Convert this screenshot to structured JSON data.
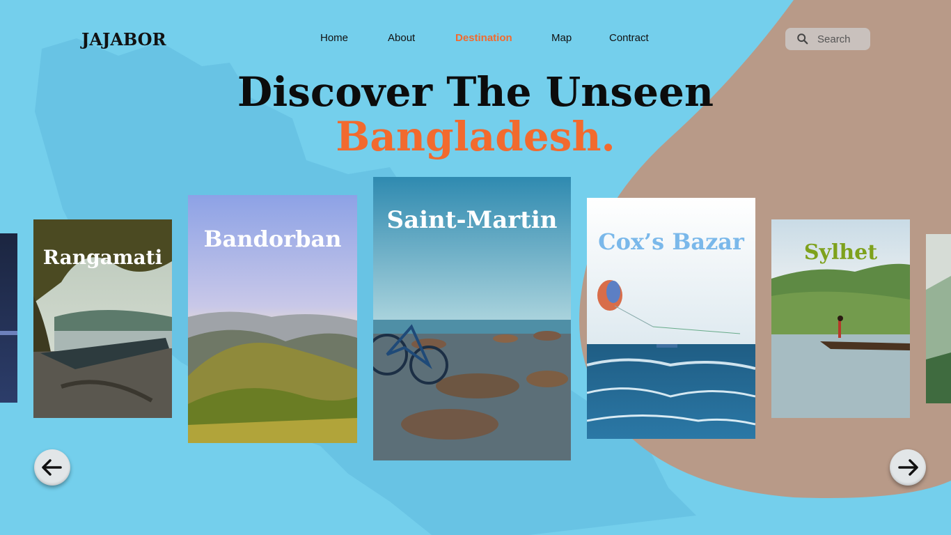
{
  "brand": {
    "logo_text": "JAJABOR"
  },
  "nav": {
    "items": [
      {
        "label": "Home"
      },
      {
        "label": "About"
      },
      {
        "label": "Destination",
        "active": true
      },
      {
        "label": "Map"
      },
      {
        "label": "Contract"
      }
    ]
  },
  "search": {
    "placeholder": "Search"
  },
  "hero": {
    "line1": "Discover The Unseen",
    "line2": "Bangladesh."
  },
  "destinations": [
    {
      "name": "Rangamati"
    },
    {
      "name": "Bandorban"
    },
    {
      "name": "Saint-Martin"
    },
    {
      "name": "Cox’s Bazar"
    },
    {
      "name": "Sylhet"
    }
  ],
  "colors": {
    "background": "#74cfec",
    "accent": "#f26a2e",
    "blob": "#b89a88",
    "cox_title": "#7ab8ea",
    "sylhet_title": "#7ea11c"
  },
  "icons": {
    "prev": "arrow-left-icon",
    "next": "arrow-right-icon",
    "search": "search-icon"
  }
}
